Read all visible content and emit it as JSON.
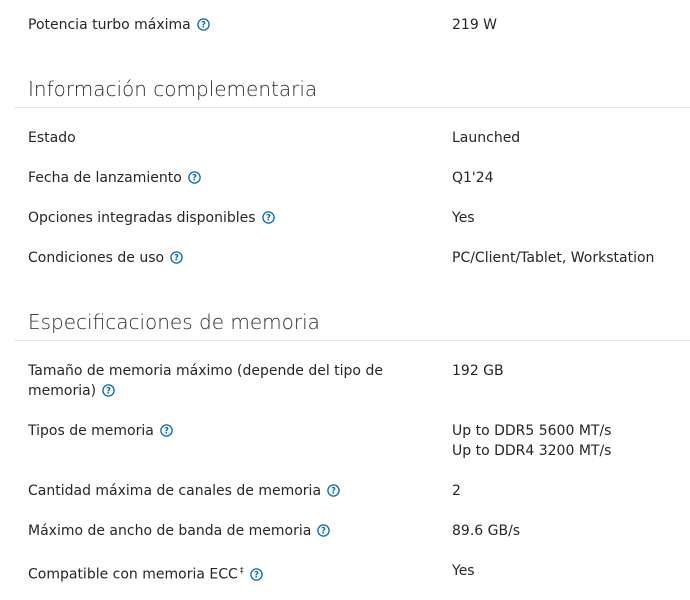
{
  "rows_top": {
    "turbo_power": {
      "label": "Potencia turbo máxima",
      "value": "219 W"
    }
  },
  "section_supplemental": {
    "title": "Información complementaria",
    "rows": [
      {
        "label": "Estado",
        "value": "Launched"
      },
      {
        "label": "Fecha de lanzamiento",
        "value": "Q1'24"
      },
      {
        "label": "Opciones integradas disponibles",
        "value": "Yes"
      },
      {
        "label": "Condiciones de uso",
        "value": "PC/Client/Tablet, Workstation"
      }
    ]
  },
  "section_memory": {
    "title": "Especificaciones de memoria",
    "rows": [
      {
        "label_line1": "Tamaño de memoria máximo (depende del tipo de",
        "label_line2": "memoria)",
        "value": "192 GB"
      },
      {
        "label": "Tipos de memoria",
        "value_line1": "Up to DDR5 5600 MT/s",
        "value_line2": "Up to DDR4 3200 MT/s"
      },
      {
        "label": "Cantidad máxima de canales de memoria",
        "value": "2"
      },
      {
        "label": "Máximo de ancho de banda de memoria",
        "value": "89.6 GB/s"
      },
      {
        "label": "Compatible con memoria ECC",
        "label_sup": "‡",
        "value": "Yes"
      }
    ]
  },
  "icons": {
    "info": "question-circle-icon"
  },
  "colors": {
    "text": "#262626",
    "info_icon": "#0068b5",
    "rule": "#e6e6e6"
  }
}
